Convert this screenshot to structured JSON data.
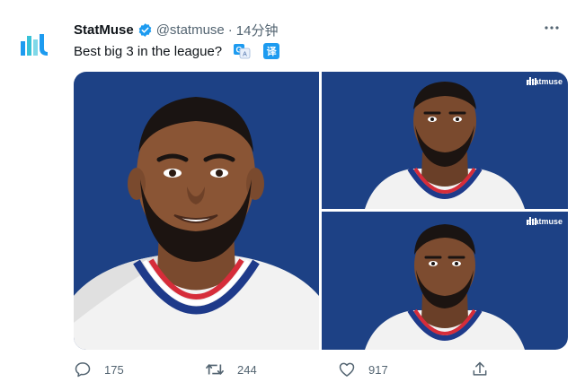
{
  "author": {
    "name": "StatMuse",
    "handle": "@statmuse",
    "separator": "·",
    "time": "14分钟",
    "avatar_icon": "statmuse-logo-icon",
    "verified_icon": "verified-badge-icon"
  },
  "tweet": {
    "text": "Best big 3 in the league?",
    "translate_icon": "translate-icon",
    "translate_badge": "译"
  },
  "media": {
    "watermark": "statmuse",
    "background_color": "#1d4185",
    "images": [
      "player-illustration-large",
      "player-illustration-top-right",
      "player-illustration-bottom-right"
    ]
  },
  "actions": {
    "reply_count": "175",
    "retweet_count": "244",
    "like_count": "917",
    "share_icon": "share-icon"
  },
  "colors": {
    "accent": "#1d9bf0",
    "muted": "#536471",
    "text": "#0f1419"
  }
}
